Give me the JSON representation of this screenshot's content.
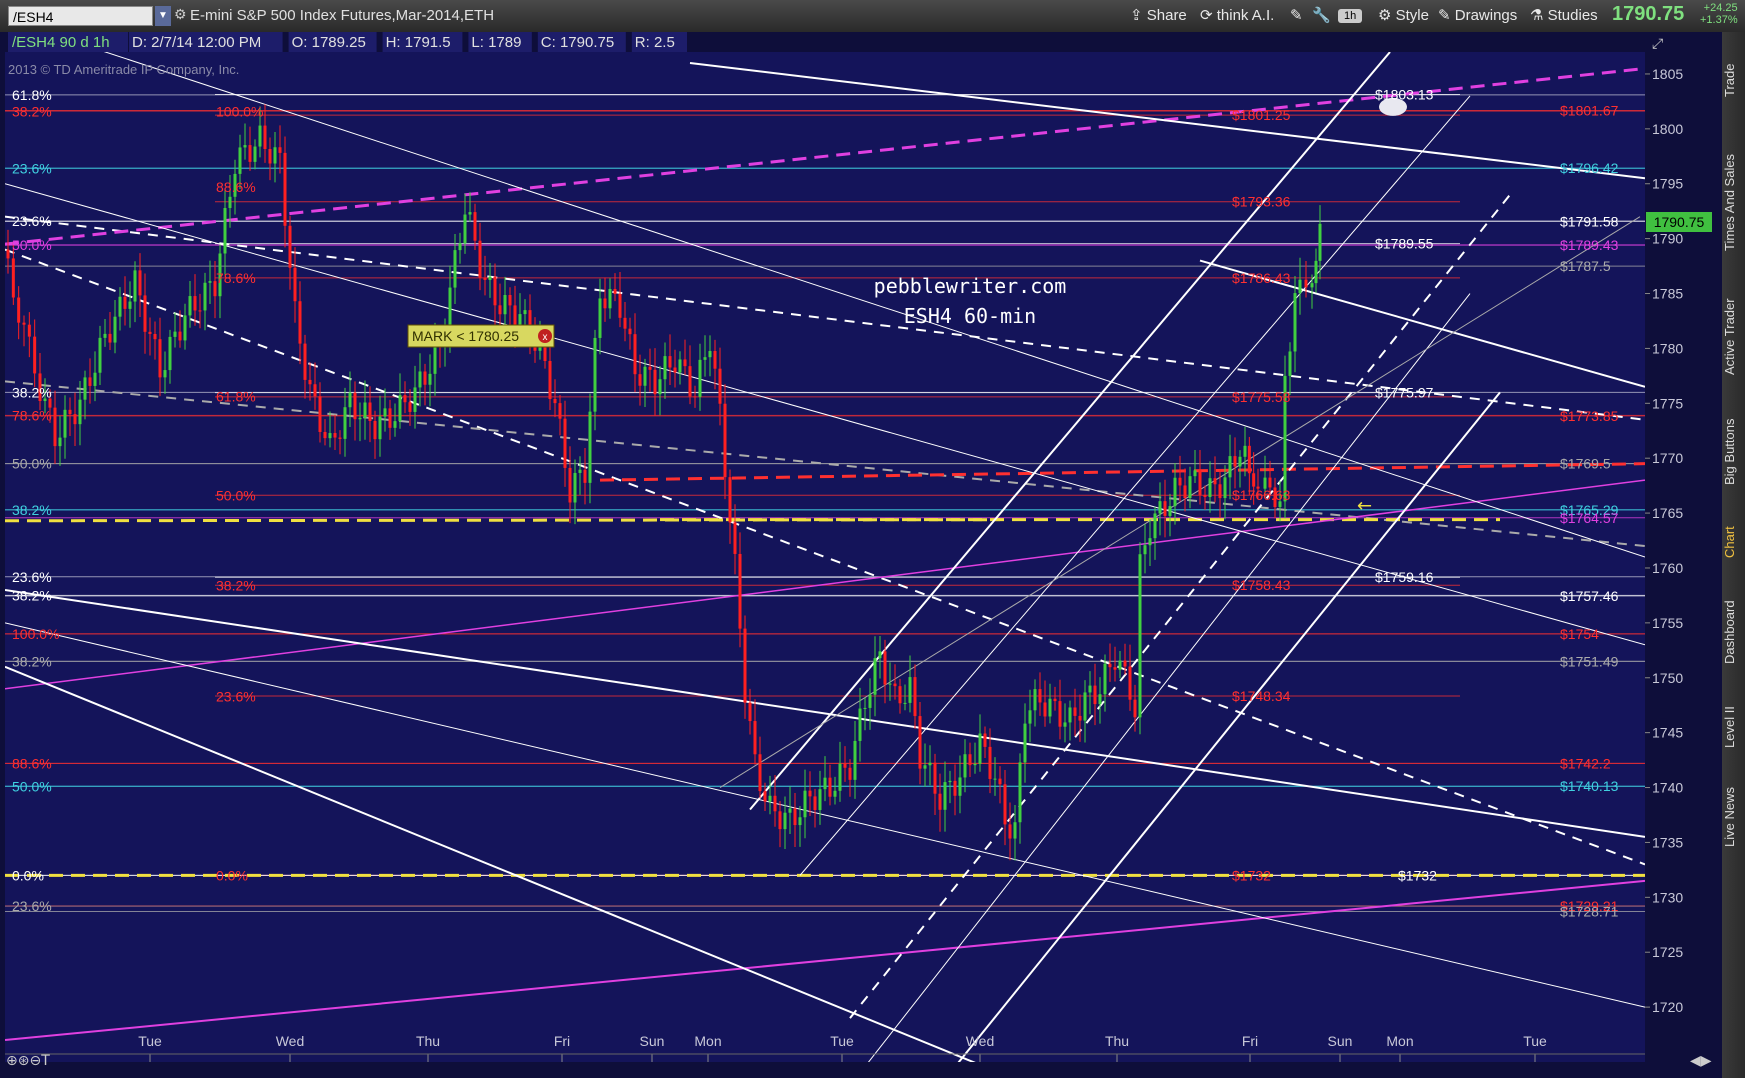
{
  "toolbar": {
    "symbol": "/ESH4",
    "title": "E-mini S&P 500 Index Futures,Mar-2014,ETH",
    "share_label": "Share",
    "think_label": "think A.I.",
    "timeframe_label": "1h",
    "style_label": "Style",
    "drawings_label": "Drawings",
    "studies_label": "Studies",
    "last_price": "1790.75",
    "change_abs": "+24.25",
    "change_pct": "+1.37%"
  },
  "side_tabs": [
    "Trade",
    "Times And Sales",
    "Active Trader",
    "Big Buttons",
    "Chart",
    "Dashboard",
    "Level II",
    "Live News"
  ],
  "colors": {
    "background": "#14145a",
    "accent_green": "#7fe07f",
    "magenta": "#e040e0",
    "red_fib": "#ff3030",
    "cyan_fib": "#40d0e0",
    "yellow": "#f0e040"
  },
  "chart_data": {
    "type": "candlestick",
    "header_info": "/ESH4 90 d 1h",
    "info_fields": [
      "D: 2/7/14 12:00 PM",
      "O: 1789.25",
      "H: 1791.5",
      "L: 1789",
      "C: 1790.75",
      "R: 2.5"
    ],
    "copyright": "2013 © TD Ameritrade IP Company, Inc.",
    "watermark": [
      "pebblewriter.com",
      "ESH4 60-min"
    ],
    "mark_label": "MARK < 1780.25",
    "price_tag": "1790.75",
    "ylim": [
      1715,
      1807
    ],
    "y_ticks": [
      1720,
      1725,
      1730,
      1735,
      1740,
      1745,
      1750,
      1755,
      1760,
      1765,
      1770,
      1775,
      1780,
      1785,
      1790,
      1795,
      1800,
      1805
    ],
    "x_ticks": [
      "Tue",
      "Wed",
      "Thu",
      "Fri",
      "Sun",
      "Mon",
      "Tue",
      "Wed",
      "Thu",
      "Fri",
      "Sun",
      "Mon",
      "Tue"
    ],
    "right_labels": [
      {
        "text": "$1803.13",
        "y": 1803.13,
        "color": "#ffffff",
        "col": "mid"
      },
      {
        "text": "$1801.67",
        "y": 1801.67,
        "color": "#ff3030",
        "col": "right"
      },
      {
        "text": "$1801.25",
        "y": 1801.25,
        "color": "#ff3030",
        "col": "midred"
      },
      {
        "text": "$1796.42",
        "y": 1796.42,
        "color": "#40d0e0",
        "col": "right"
      },
      {
        "text": "$1793.36",
        "y": 1793.36,
        "color": "#ff3030",
        "col": "midred"
      },
      {
        "text": "$1791.58",
        "y": 1791.58,
        "color": "#ffffff",
        "col": "right"
      },
      {
        "text": "$1789.55",
        "y": 1789.55,
        "color": "#ffffff",
        "col": "mid"
      },
      {
        "text": "$1789.43",
        "y": 1789.43,
        "color": "#e040e0",
        "col": "right"
      },
      {
        "text": "$1787.5",
        "y": 1787.5,
        "color": "#aaaaaa",
        "col": "right"
      },
      {
        "text": "$1786.43",
        "y": 1786.43,
        "color": "#ff3030",
        "col": "midred"
      },
      {
        "text": "$1775.97",
        "y": 1775.97,
        "color": "#ffffff",
        "col": "mid"
      },
      {
        "text": "$1775.58",
        "y": 1775.58,
        "color": "#ff3030",
        "col": "midred"
      },
      {
        "text": "$1773.85",
        "y": 1773.85,
        "color": "#ff3030",
        "col": "right"
      },
      {
        "text": "$1769.5",
        "y": 1769.5,
        "color": "#aaaaaa",
        "col": "right"
      },
      {
        "text": "$1766.63",
        "y": 1766.63,
        "color": "#ff3030",
        "col": "midred"
      },
      {
        "text": "$1765.29",
        "y": 1765.29,
        "color": "#40d0e0",
        "col": "right"
      },
      {
        "text": "$1764.57",
        "y": 1764.57,
        "color": "#e040e0",
        "col": "right"
      },
      {
        "text": "$1759.16",
        "y": 1759.16,
        "color": "#ffffff",
        "col": "mid"
      },
      {
        "text": "$1758.43",
        "y": 1758.43,
        "color": "#ff3030",
        "col": "midred"
      },
      {
        "text": "$1757.46",
        "y": 1757.46,
        "color": "#ffffff",
        "col": "right"
      },
      {
        "text": "$1754",
        "y": 1754,
        "color": "#ff3030",
        "col": "right"
      },
      {
        "text": "$1751.49",
        "y": 1751.49,
        "color": "#aaaaaa",
        "col": "right"
      },
      {
        "text": "$1748.34",
        "y": 1748.34,
        "color": "#ff3030",
        "col": "midred"
      },
      {
        "text": "$1742.2",
        "y": 1742.2,
        "color": "#ff3030",
        "col": "right"
      },
      {
        "text": "$1740.13",
        "y": 1740.13,
        "color": "#40d0e0",
        "col": "right"
      },
      {
        "text": "$1732",
        "y": 1732,
        "color": "#ff3030",
        "col": "midred"
      },
      {
        "text": "$1732",
        "y": 1732,
        "color": "#ffffff",
        "col": "mid2"
      },
      {
        "text": "$1729.21",
        "y": 1729.21,
        "color": "#ff3030",
        "col": "right"
      },
      {
        "text": "$1728.71",
        "y": 1728.71,
        "color": "#aaaaaa",
        "col": "right"
      }
    ],
    "left_fib_labels": [
      {
        "text": "61.8%",
        "y": 1803.1,
        "color": "#ffffff"
      },
      {
        "text": "38.2%",
        "y": 1801.6,
        "color": "#ff3030"
      },
      {
        "text": "23.6%",
        "y": 1796.4,
        "color": "#40d0e0"
      },
      {
        "text": "23.6%",
        "y": 1791.6,
        "color": "#ffffff"
      },
      {
        "text": "50.0%",
        "y": 1789.4,
        "color": "#e040e0"
      },
      {
        "text": "38.2%",
        "y": 1776.0,
        "color": "#ffffff"
      },
      {
        "text": "78.6%",
        "y": 1773.9,
        "color": "#ff3030"
      },
      {
        "text": "50.0%",
        "y": 1769.5,
        "color": "#aaaaaa"
      },
      {
        "text": "38.2%",
        "y": 1765.3,
        "color": "#40d0e0"
      },
      {
        "text": "23.6%",
        "y": 1759.2,
        "color": "#ffffff"
      },
      {
        "text": "38.2%",
        "y": 1757.5,
        "color": "#ffffff"
      },
      {
        "text": "100.0%",
        "y": 1754.0,
        "color": "#ff3030"
      },
      {
        "text": "38.2%",
        "y": 1751.5,
        "color": "#aaaaaa"
      },
      {
        "text": "88.6%",
        "y": 1742.2,
        "color": "#ff3030"
      },
      {
        "text": "50.0%",
        "y": 1740.1,
        "color": "#40d0e0"
      },
      {
        "text": "0.0%",
        "y": 1732.0,
        "color": "#ffffff"
      },
      {
        "text": "23.6%",
        "y": 1729.2,
        "color": "#aaaaaa"
      }
    ],
    "mid_fib_labels": [
      {
        "text": "100.0%",
        "y": 1801.6
      },
      {
        "text": "88.6%",
        "y": 1794.7
      },
      {
        "text": "78.6%",
        "y": 1786.4
      },
      {
        "text": "61.8%",
        "y": 1775.6
      },
      {
        "text": "50.0%",
        "y": 1766.6
      },
      {
        "text": "38.2%",
        "y": 1758.4
      },
      {
        "text": "23.6%",
        "y": 1748.3
      },
      {
        "text": "0.0%",
        "y": 1732.0
      }
    ]
  }
}
